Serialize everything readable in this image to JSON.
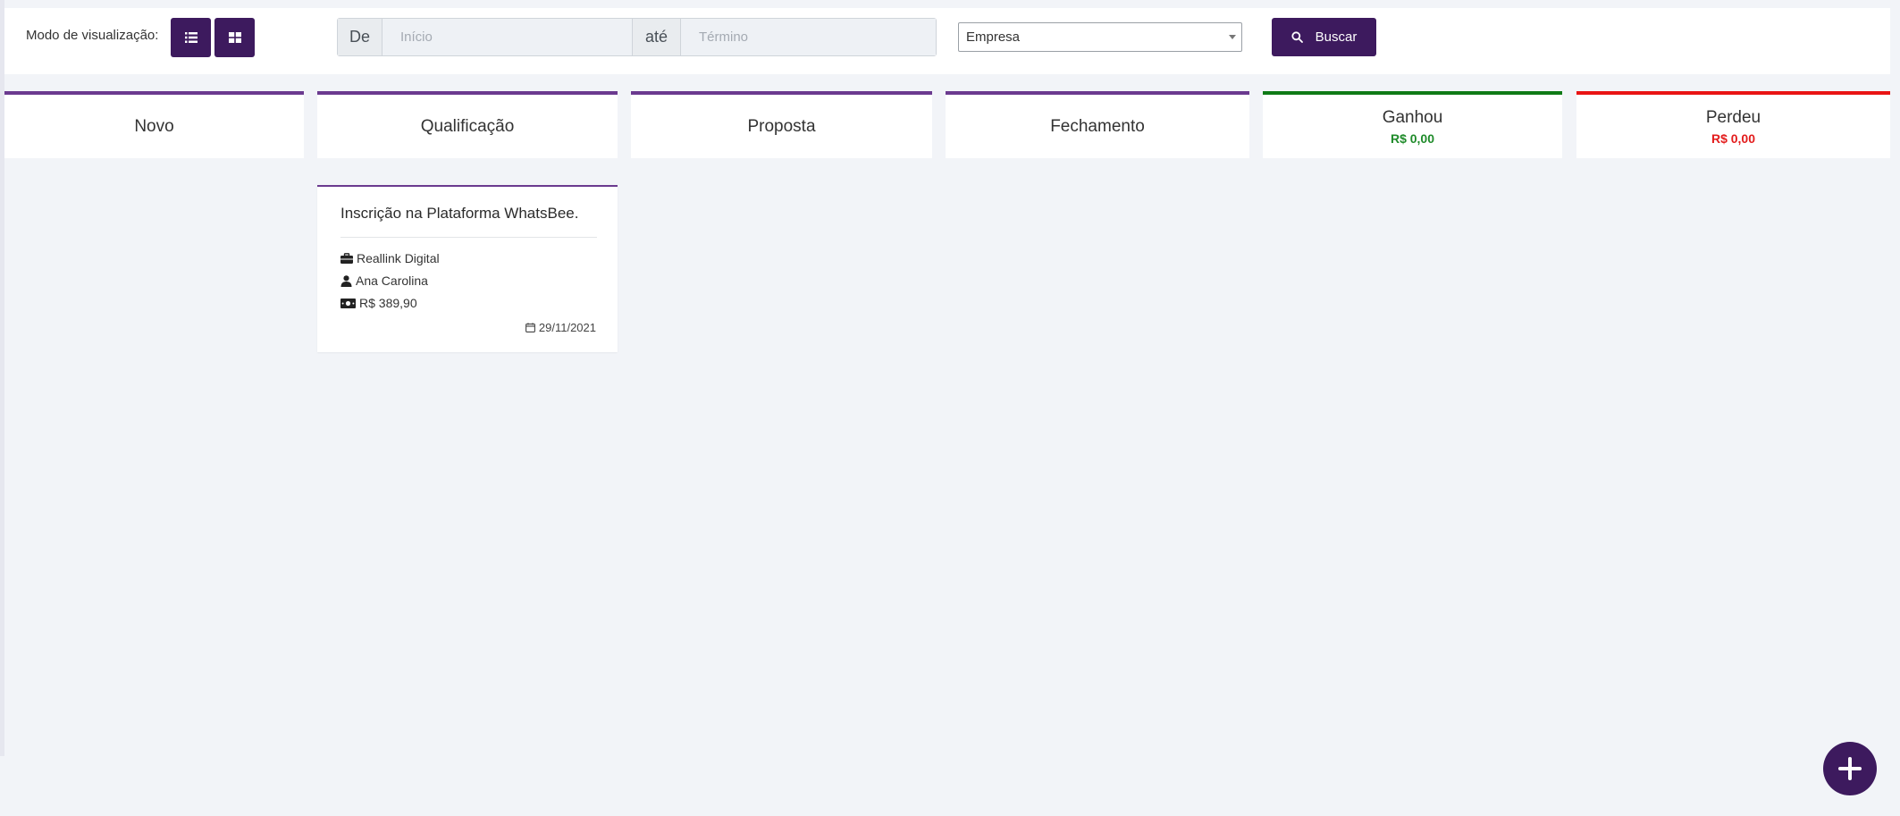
{
  "toolbar": {
    "view_label": "Modo de visualização:",
    "list_view_icon": "list-icon",
    "grid_view_icon": "grid-icon",
    "date_from_label": "De",
    "date_start_placeholder": "Início",
    "date_to_label": "até",
    "date_end_placeholder": "Término",
    "company_select_value": "Empresa",
    "search_icon": "search-icon",
    "search_label": "Buscar"
  },
  "columns": [
    {
      "title": "Novo"
    },
    {
      "title": "Qualificação"
    },
    {
      "title": "Proposta"
    },
    {
      "title": "Fechamento"
    },
    {
      "title": "Ganhou",
      "amount": "R$ 0,00"
    },
    {
      "title": "Perdeu",
      "amount": "R$ 0,00"
    }
  ],
  "card": {
    "title": "Inscrição na Plataforma WhatsBee.",
    "company": "Reallink Digital",
    "contact": "Ana Carolina",
    "value": "R$ 389,90",
    "date": "29/11/2021"
  },
  "colors": {
    "primary": "#3d1a5e",
    "column_accent": "#6b3a8f",
    "won": "#0f7a16",
    "lost": "#e91414"
  },
  "fab": {
    "icon": "plus-icon"
  }
}
